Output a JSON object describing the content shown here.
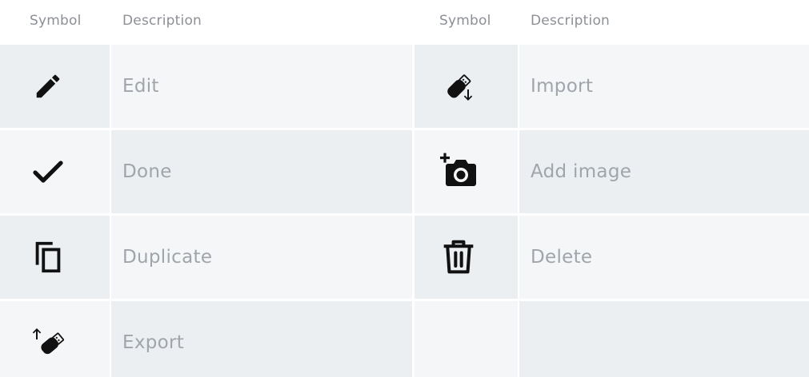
{
  "headers": {
    "left": {
      "symbol": "Symbol",
      "description": "Description"
    },
    "right": {
      "symbol": "Symbol",
      "description": "Description"
    }
  },
  "rows_left": [
    {
      "icon": "pencil-icon",
      "label": "Edit"
    },
    {
      "icon": "checkmark-icon",
      "label": "Done"
    },
    {
      "icon": "copy-icon",
      "label": "Duplicate"
    },
    {
      "icon": "usb-export-icon",
      "label": "Export"
    }
  ],
  "rows_right": [
    {
      "icon": "usb-import-icon",
      "label": "Import"
    },
    {
      "icon": "add-photo-icon",
      "label": "Add image"
    },
    {
      "icon": "trash-icon",
      "label": "Delete"
    },
    {
      "icon": "",
      "label": ""
    }
  ],
  "colors": {
    "row_shade_dark": "#eceff2",
    "row_shade_light": "#f5f6f8",
    "icon": "#111111",
    "label": "#a0a5ab",
    "header": "#8c9096"
  }
}
